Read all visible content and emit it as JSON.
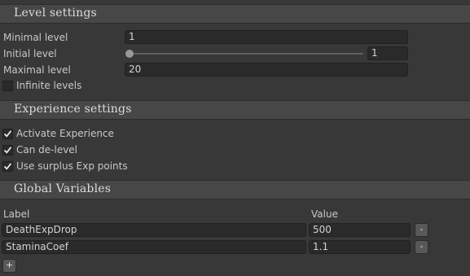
{
  "level_settings": {
    "title": "Level settings",
    "minimal_level": {
      "label": "Minimal level",
      "value": "1"
    },
    "initial_level": {
      "label": "Initial level",
      "value": "1",
      "slider_fraction": 0.0
    },
    "maximal_level": {
      "label": "Maximal level",
      "value": "20"
    },
    "infinite_levels": {
      "label": "Infinite levels",
      "checked": false
    }
  },
  "experience_settings": {
    "title": "Experience settings",
    "activate_experience": {
      "label": "Activate Experience",
      "checked": true
    },
    "can_delevel": {
      "label": "Can de-level",
      "checked": true
    },
    "use_surplus": {
      "label": "Use surplus Exp points",
      "checked": true
    }
  },
  "global_variables": {
    "title": "Global Variables",
    "col_label": "Label",
    "col_value": "Value",
    "rows": [
      {
        "label": "DeathExpDrop",
        "value": "500"
      },
      {
        "label": "StaminaCoef",
        "value": "1.1"
      }
    ],
    "remove_label": "-",
    "add_label": "+"
  },
  "colors": {
    "background": "#383838",
    "header": "#474747",
    "field": "#2a2a2a"
  }
}
